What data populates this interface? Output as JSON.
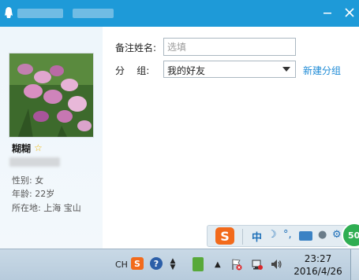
{
  "titlebar": {
    "minimize_icon": "minimize-icon",
    "close_icon": "close-icon",
    "logo_icon": "qq-penguin-icon"
  },
  "profile": {
    "nickname": "糊糊",
    "gender": "性别: 女",
    "age": "年龄: 22岁",
    "location": "所在地: 上海  宝山"
  },
  "form": {
    "remark_label": "备注姓名:",
    "remark_placeholder": "选填",
    "group_label": "分    组:",
    "group_value": "我的好友",
    "new_group_link": "新建分组"
  },
  "ime": {
    "logo": "S",
    "mode": "中",
    "moon": "☽",
    "punctuation": "°,"
  },
  "badge": {
    "value": "50"
  },
  "taskbar": {
    "lang": "CH",
    "sogou": "S",
    "help": "?",
    "time": "23:27",
    "date": "2016/4/26"
  },
  "colors": {
    "titlebar": "#1e9ad8",
    "link": "#1e8bd6",
    "ime_accent": "#f26a1b",
    "badge": "#2fae52"
  }
}
